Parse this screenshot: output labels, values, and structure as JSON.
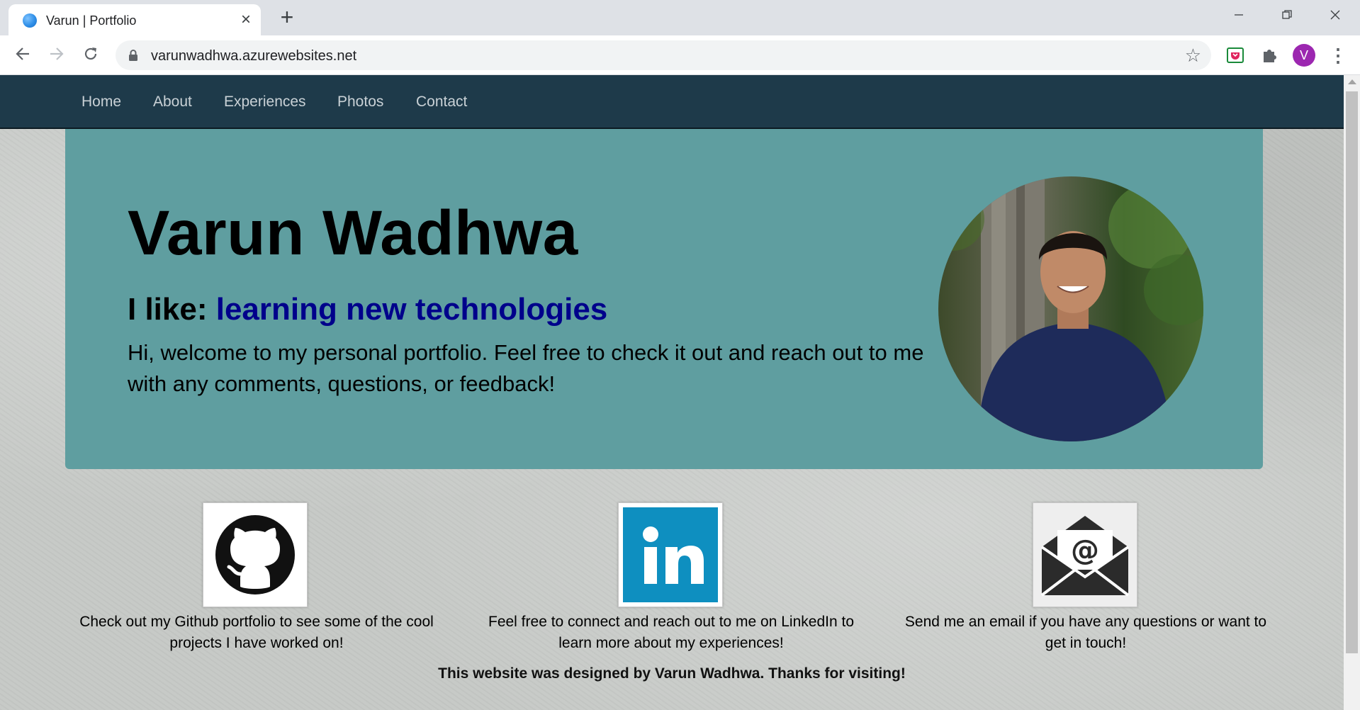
{
  "browser": {
    "tab_title": "Varun | Portfolio",
    "tab_close": "×",
    "new_tab": "+",
    "url": "varunwadhwa.azurewebsites.net",
    "profile_initial": "V",
    "icons": [
      "back-arrow-icon",
      "forward-arrow-icon",
      "reload-icon",
      "lock-icon",
      "star-icon",
      "pocket-extension-icon",
      "puzzle-extensions-icon",
      "kebab-menu-icon"
    ]
  },
  "nav": {
    "items": [
      "Home",
      "About",
      "Experiences",
      "Photos",
      "Contact"
    ]
  },
  "hero": {
    "name": "Varun Wadhwa",
    "like_label": "I like: ",
    "like_value": "learning new technologies",
    "description": "Hi, welcome to my personal portfolio. Feel free to check it out and reach out to me with any comments, questions, or feedback!",
    "background_color": "#5f9ea0"
  },
  "cards": [
    {
      "icon": "github-icon",
      "text": "Check out my Github portfolio to see some of the cool projects I have worked on!"
    },
    {
      "icon": "linkedin-icon",
      "text": "Feel free to connect and reach out to me on LinkedIn to learn more about my experiences!"
    },
    {
      "icon": "email-icon",
      "text": "Send me an email if you have any questions or want to get in touch!"
    }
  ],
  "footer": {
    "text": "This website was designed by Varun Wadhwa. Thanks for visiting!"
  },
  "colors": {
    "navbar": "#1e3a4a",
    "like_value": "#00008b",
    "linkedin": "#0e8fc0"
  }
}
